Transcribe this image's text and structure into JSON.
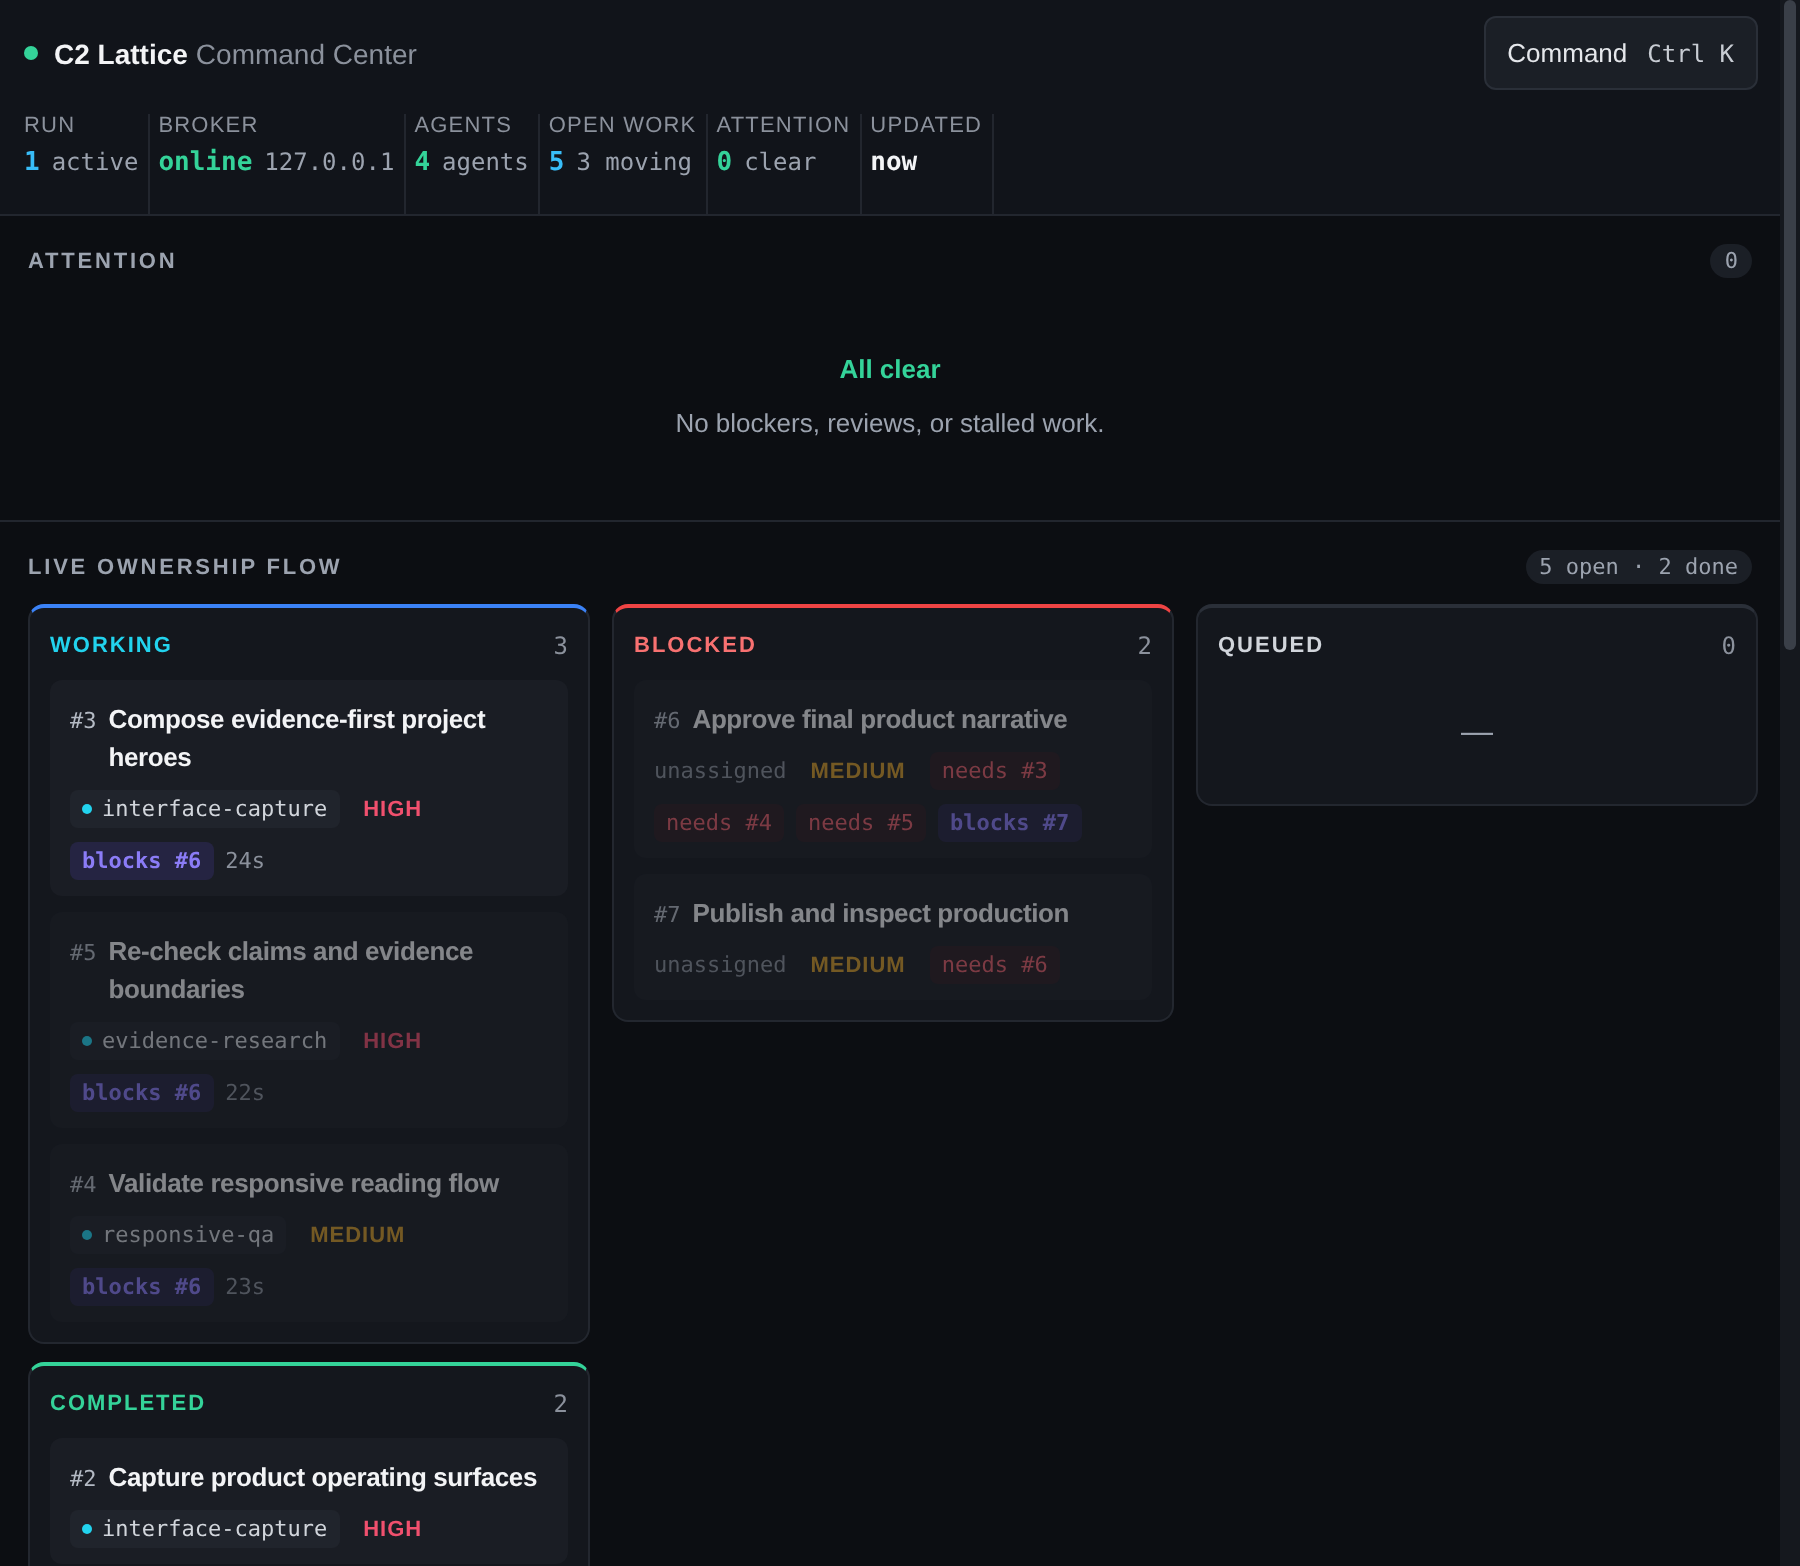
{
  "header": {
    "status_on": true,
    "brand": "C2 Lattice",
    "subtitle": "Command Center",
    "command": {
      "label": "Command",
      "shortcut": "Ctrl K"
    }
  },
  "stats": [
    {
      "label": "RUN",
      "value": "1",
      "detail": "active",
      "color": "#38bdf8"
    },
    {
      "label": "BROKER",
      "value": "online",
      "detail": "127.0.0.1",
      "color": "#34d399"
    },
    {
      "label": "AGENTS",
      "value": "4",
      "detail": "agents",
      "color": "#34d399"
    },
    {
      "label": "OPEN WORK",
      "value": "5",
      "detail": "3 moving",
      "color": "#38bdf8"
    },
    {
      "label": "ATTENTION",
      "value": "0",
      "detail": "clear",
      "color": "#34d399"
    },
    {
      "label": "UPDATED",
      "value": "now",
      "color": "#f3f4f6"
    }
  ],
  "attention": {
    "title": "ATTENTION",
    "count": "0",
    "empty_title": "All clear",
    "empty_message": "No blockers, reviews, or stalled work."
  },
  "flow": {
    "title": "LIVE OWNERSHIP FLOW",
    "summary": "5 open · 2 done",
    "lanes": [
      {
        "kind": "working",
        "title": "WORKING",
        "count": "3",
        "cards": [
          {
            "id": "#3",
            "title": "Compose evidence-first project heroes",
            "dimmed": false,
            "tags": [
              {
                "kind": "agent",
                "text": "interface-capture"
              },
              {
                "kind": "high",
                "text": "HIGH"
              },
              {
                "kind": "blocks",
                "text": "blocks #6"
              },
              {
                "kind": "age",
                "text": "24s"
              }
            ]
          },
          {
            "id": "#5",
            "title": "Re-check claims and evidence boundaries",
            "dimmed": true,
            "tags": [
              {
                "kind": "agent",
                "text": "evidence-research"
              },
              {
                "kind": "high",
                "text": "HIGH"
              },
              {
                "kind": "blocks",
                "text": "blocks #6"
              },
              {
                "kind": "age",
                "text": "22s"
              }
            ]
          },
          {
            "id": "#4",
            "title": "Validate responsive reading flow",
            "dimmed": true,
            "tags": [
              {
                "kind": "agent",
                "text": "responsive-qa"
              },
              {
                "kind": "medium",
                "text": "MEDIUM"
              },
              {
                "kind": "blocks",
                "text": "blocks #6"
              },
              {
                "kind": "age",
                "text": "23s"
              }
            ]
          }
        ]
      },
      {
        "kind": "blocked",
        "title": "BLOCKED",
        "count": "2",
        "cards": [
          {
            "id": "#6",
            "title": "Approve final product narrative",
            "dimmed": true,
            "tags": [
              {
                "kind": "unassigned",
                "text": "unassigned"
              },
              {
                "kind": "medium",
                "text": "MEDIUM"
              },
              {
                "kind": "needs",
                "text": "needs #3"
              },
              {
                "kind": "needs",
                "text": "needs #4"
              },
              {
                "kind": "needs",
                "text": "needs #5"
              },
              {
                "kind": "blocks",
                "text": "blocks #7"
              }
            ]
          },
          {
            "id": "#7",
            "title": "Publish and inspect production",
            "dimmed": true,
            "tags": [
              {
                "kind": "unassigned",
                "text": "unassigned"
              },
              {
                "kind": "medium",
                "text": "MEDIUM"
              },
              {
                "kind": "needs",
                "text": "needs #6"
              }
            ]
          }
        ]
      },
      {
        "kind": "queued",
        "title": "QUEUED",
        "count": "0",
        "empty": "—"
      },
      {
        "kind": "completed",
        "title": "COMPLETED",
        "count": "2",
        "cards": [
          {
            "id": "#2",
            "title": "Capture product operating surfaces",
            "dimmed": false,
            "tags": [
              {
                "kind": "agent",
                "text": "interface-capture"
              },
              {
                "kind": "high",
                "text": "HIGH"
              }
            ]
          }
        ]
      }
    ]
  }
}
